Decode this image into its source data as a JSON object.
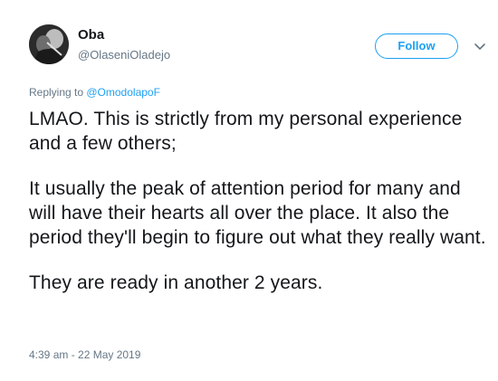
{
  "user": {
    "display_name": "Oba",
    "handle": "@OlaseniOladejo",
    "avatar_icon": "profile-photo"
  },
  "actions": {
    "follow_label": "Follow",
    "more_icon": "chevron-down-icon"
  },
  "reply": {
    "prefix": "Replying to ",
    "mention": "@OmodolapoF"
  },
  "tweet": {
    "paragraphs": [
      "LMAO. This is strictly from my personal experience and a few others;",
      "It usually the peak of attention period for many and will have their hearts all over the place. It also the period they'll begin to figure out what they really want.",
      "They are ready in another 2 years."
    ]
  },
  "meta": {
    "timestamp": "4:39 am - 22 May 2019"
  },
  "colors": {
    "accent": "#1da1f2",
    "secondary_text": "#657786",
    "primary_text": "#14171a"
  }
}
